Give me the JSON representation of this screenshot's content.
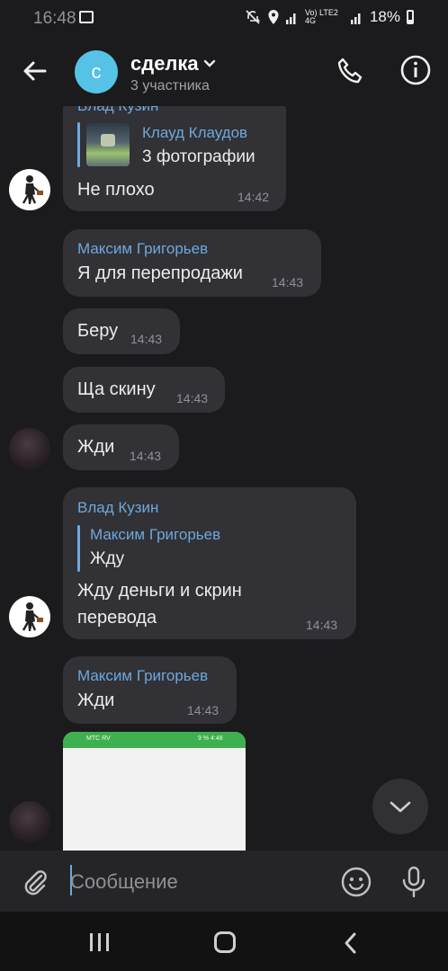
{
  "status_bar": {
    "time": "16:48",
    "network": "Vo) LTE2 4G",
    "battery": "18%"
  },
  "header": {
    "chat_avatar_letter": "с",
    "title": "сделка",
    "subtitle": "3 участника"
  },
  "messages": [
    {
      "sender": "Влад Кузин",
      "quote_sender": "Клауд Клаудов",
      "quote_text": "3 фотографии",
      "text": "Не плохо",
      "time": "14:42"
    },
    {
      "sender": "Максим Григорьев",
      "text": "Я для перепродажи",
      "time": "14:43"
    },
    {
      "text": "Беру",
      "time": "14:43"
    },
    {
      "text": "Ща скину",
      "time": "14:43"
    },
    {
      "text": "Жди",
      "time": "14:43"
    },
    {
      "sender": "Влад Кузин",
      "quote_sender": "Максим Григорьев",
      "quote_text": "Жду",
      "text_line1": "Жду деньги и скрин",
      "text_line2": "перевода",
      "time": "14:43"
    },
    {
      "sender": "Максим Григорьев",
      "text": "Жди",
      "time": "14:43"
    }
  ],
  "screenshot_preview": {
    "left_text": "МТС RV",
    "right_text": "9 % 4:48"
  },
  "composer": {
    "placeholder": "Сообщение"
  },
  "colors": {
    "background": "#1b1b1d",
    "bubble": "#313136",
    "accent": "#6fa8dc",
    "group_avatar": "#56c2e5"
  }
}
